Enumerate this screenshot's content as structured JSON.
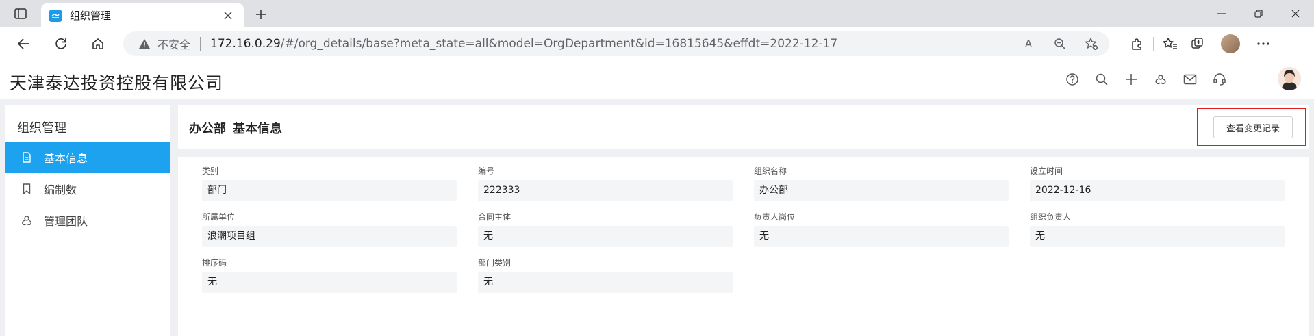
{
  "browser": {
    "tab_title": "组织管理",
    "security_label": "不安全",
    "url_host": "172.16.0.29",
    "url_path": "/#/org_details/base?meta_state=all&model=OrgDepartment&id=16815645&effdt=2022-12-17",
    "read_aloud_label": "A"
  },
  "app": {
    "company_name": "天津泰达投资控股有限公司"
  },
  "sidebar": {
    "title": "组织管理",
    "items": [
      {
        "label": "基本信息",
        "icon": "document-icon",
        "active": true
      },
      {
        "label": "编制数",
        "icon": "bookmark-icon",
        "active": false
      },
      {
        "label": "管理团队",
        "icon": "team-icon",
        "active": false
      }
    ]
  },
  "main": {
    "department": "办公部",
    "section": "基本信息",
    "history_button": "查看变更记录"
  },
  "fields": [
    {
      "label": "类别",
      "value": "部门"
    },
    {
      "label": "编号",
      "value": "222333"
    },
    {
      "label": "组织名称",
      "value": "办公部"
    },
    {
      "label": "设立时间",
      "value": "2022-12-16"
    },
    {
      "label": "所属单位",
      "value": "浪潮项目组"
    },
    {
      "label": "合同主体",
      "value": "无"
    },
    {
      "label": "负责人岗位",
      "value": "无"
    },
    {
      "label": "组织负责人",
      "value": "无"
    },
    {
      "label": "排序码",
      "value": "无"
    },
    {
      "label": "部门类别",
      "value": "无"
    }
  ],
  "colors": {
    "accent": "#1ca2ee",
    "highlight": "#e31b1b"
  }
}
